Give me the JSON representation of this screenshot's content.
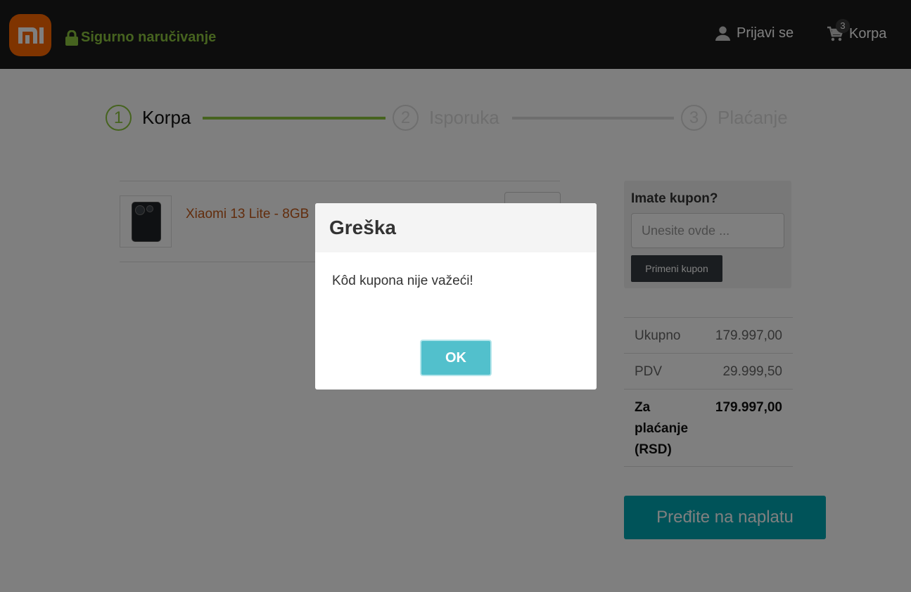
{
  "header": {
    "logo_text": "mi",
    "secure_label": "Sigurno naručivanje",
    "login_label": "Prijavi se",
    "cart_label": "Korpa",
    "cart_count": "3"
  },
  "steps": [
    {
      "number": "1",
      "label": "Korpa"
    },
    {
      "number": "2",
      "label": "Isporuka"
    },
    {
      "number": "3",
      "label": "Plaćanje"
    }
  ],
  "cart": {
    "product_name": "Xiaomi 13 Lite - 8GB"
  },
  "coupon": {
    "title": "Imate kupon?",
    "placeholder": "Unesite ovde ...",
    "apply_label": "Primeni kupon"
  },
  "totals": {
    "subtotal_label": "Ukupno",
    "subtotal_value": "179.997,00",
    "tax_label": "PDV",
    "tax_value": "29.999,50",
    "total_label": "Za plaćanje (RSD)",
    "total_value": "179.997,00"
  },
  "checkout_label": "Pređite na naplatu",
  "modal": {
    "title": "Greška",
    "message": "Kôd kupona nije važeći!",
    "ok_label": "OK"
  },
  "colors": {
    "accent_green": "#8dc63f",
    "brand_orange": "#ff6900",
    "checkout_teal": "#00a6b3",
    "ok_button": "#52c0cc"
  }
}
